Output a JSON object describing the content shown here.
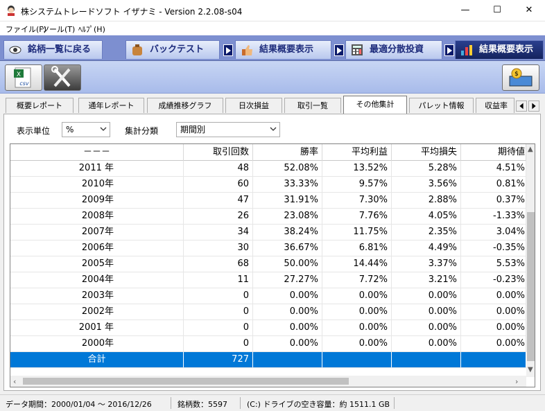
{
  "window": {
    "title": "株システムトレードソフト イザナミ - Version 2.2.08-s04",
    "minimize": "—",
    "maximize": "☐",
    "close": "✕"
  },
  "menu": [
    "ファイル(F)",
    "ツール(T)",
    "ﾍﾙﾌﾟ(H)"
  ],
  "nav": {
    "back": "銘柄一覧に戻る",
    "backtest": "バックテスト",
    "results": "結果概要表示",
    "optimize": "最適分散投資",
    "results_active": "結果概要表示"
  },
  "subtabs": [
    "概要レポート",
    "通年レポート",
    "成績推移グラフ",
    "日次損益",
    "取引一覧",
    "その他集計",
    "パレット情報",
    "収益率"
  ],
  "active_subtab": "その他集計",
  "filters": {
    "unit_label": "表示単位",
    "unit_value": "%",
    "category_label": "集計分類",
    "category_value": "期間別"
  },
  "table": {
    "headers": [
      "－－－",
      "取引回数",
      "勝率",
      "平均利益",
      "平均損失",
      "期待値"
    ],
    "rows": [
      [
        "2011 年",
        "48",
        "52.08%",
        "13.52%",
        "5.28%",
        "4.51%"
      ],
      [
        "2010年",
        "60",
        "33.33%",
        "9.57%",
        "3.56%",
        "0.81%"
      ],
      [
        "2009年",
        "47",
        "31.91%",
        "7.30%",
        "2.88%",
        "0.37%"
      ],
      [
        "2008年",
        "26",
        "23.08%",
        "7.76%",
        "4.05%",
        "-1.33%"
      ],
      [
        "2007年",
        "34",
        "38.24%",
        "11.75%",
        "2.35%",
        "3.04%"
      ],
      [
        "2006年",
        "30",
        "36.67%",
        "6.81%",
        "4.49%",
        "-0.35%"
      ],
      [
        "2005年",
        "68",
        "50.00%",
        "14.44%",
        "3.37%",
        "5.53%"
      ],
      [
        "2004年",
        "11",
        "27.27%",
        "7.72%",
        "3.21%",
        "-0.23%"
      ],
      [
        "2003年",
        "0",
        "0.00%",
        "0.00%",
        "0.00%",
        "0.00%"
      ],
      [
        "2002年",
        "0",
        "0.00%",
        "0.00%",
        "0.00%",
        "0.00%"
      ],
      [
        "2001 年",
        "0",
        "0.00%",
        "0.00%",
        "0.00%",
        "0.00%"
      ],
      [
        "2000年",
        "0",
        "0.00%",
        "0.00%",
        "0.00%",
        "0.00%"
      ]
    ],
    "total": [
      "合計",
      "727",
      "",
      "",
      "",
      ""
    ]
  },
  "status": {
    "period": "データ期間：2000/01/04 〜 2016/12/26",
    "stocks": "銘柄数：5597",
    "disk": "(C:) ドライブの空き容量：約 1511.1 GB"
  }
}
